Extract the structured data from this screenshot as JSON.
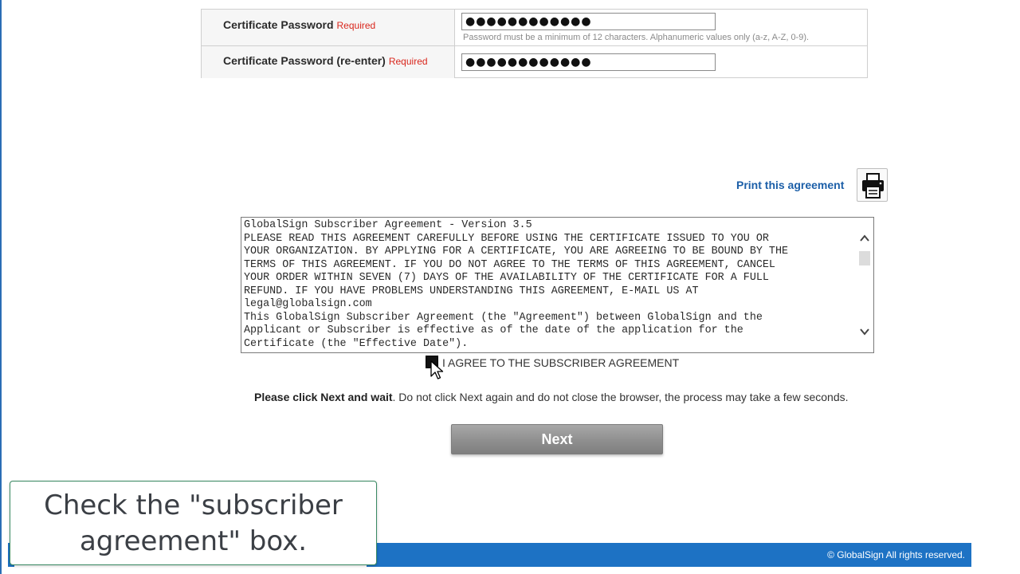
{
  "password_section": {
    "password_label": "Certificate Password",
    "password_required": "Required",
    "password_value": "●●●●●●●●●●●●",
    "password_hint": "Password must be a minimum of 12 characters. Alphanumeric values only (a-z, A-Z, 0-9).",
    "reenter_label": "Certificate Password (re-enter)",
    "reenter_required": "Required",
    "reenter_value": "●●●●●●●●●●●●"
  },
  "print": {
    "link_label": "Print this agreement",
    "icon": "printer-icon"
  },
  "agreement": {
    "text": "GlobalSign Subscriber Agreement - Version 3.5\nPLEASE READ THIS AGREEMENT CAREFULLY BEFORE USING THE CERTIFICATE ISSUED TO YOU OR\nYOUR ORGANIZATION. BY APPLYING FOR A CERTIFICATE, YOU ARE AGREEING TO BE BOUND BY THE\nTERMS OF THIS AGREEMENT. IF YOU DO NOT AGREE TO THE TERMS OF THIS AGREEMENT, CANCEL\nYOUR ORDER WITHIN SEVEN (7) DAYS OF THE AVAILABILITY OF THE CERTIFICATE FOR A FULL\nREFUND. IF YOU HAVE PROBLEMS UNDERSTANDING THIS AGREEMENT, E-MAIL US AT\nlegal@globalsign.com\nThis GlobalSign Subscriber Agreement (the \"Agreement\") between GlobalSign and the\nApplicant or Subscriber is effective as of the date of the application for the\nCertificate (the \"Effective Date\")."
  },
  "checkbox": {
    "label": "I AGREE TO THE SUBSCRIBER AGREEMENT",
    "checked": true
  },
  "wait_note": {
    "bold": "Please click Next and wait",
    "rest": ". Do not click Next again and do not close the browser, the process may take a few seconds."
  },
  "next_button": {
    "label": "Next"
  },
  "footer": {
    "copyright": "© GlobalSign All rights reserved."
  },
  "caption": {
    "line1": "Check the \"subscriber",
    "line2": "agreement\" box."
  },
  "colors": {
    "link": "#1c5fa8",
    "required": "#d9261c",
    "footer_bar": "#1d72c4",
    "button": "#8f8f8f"
  }
}
